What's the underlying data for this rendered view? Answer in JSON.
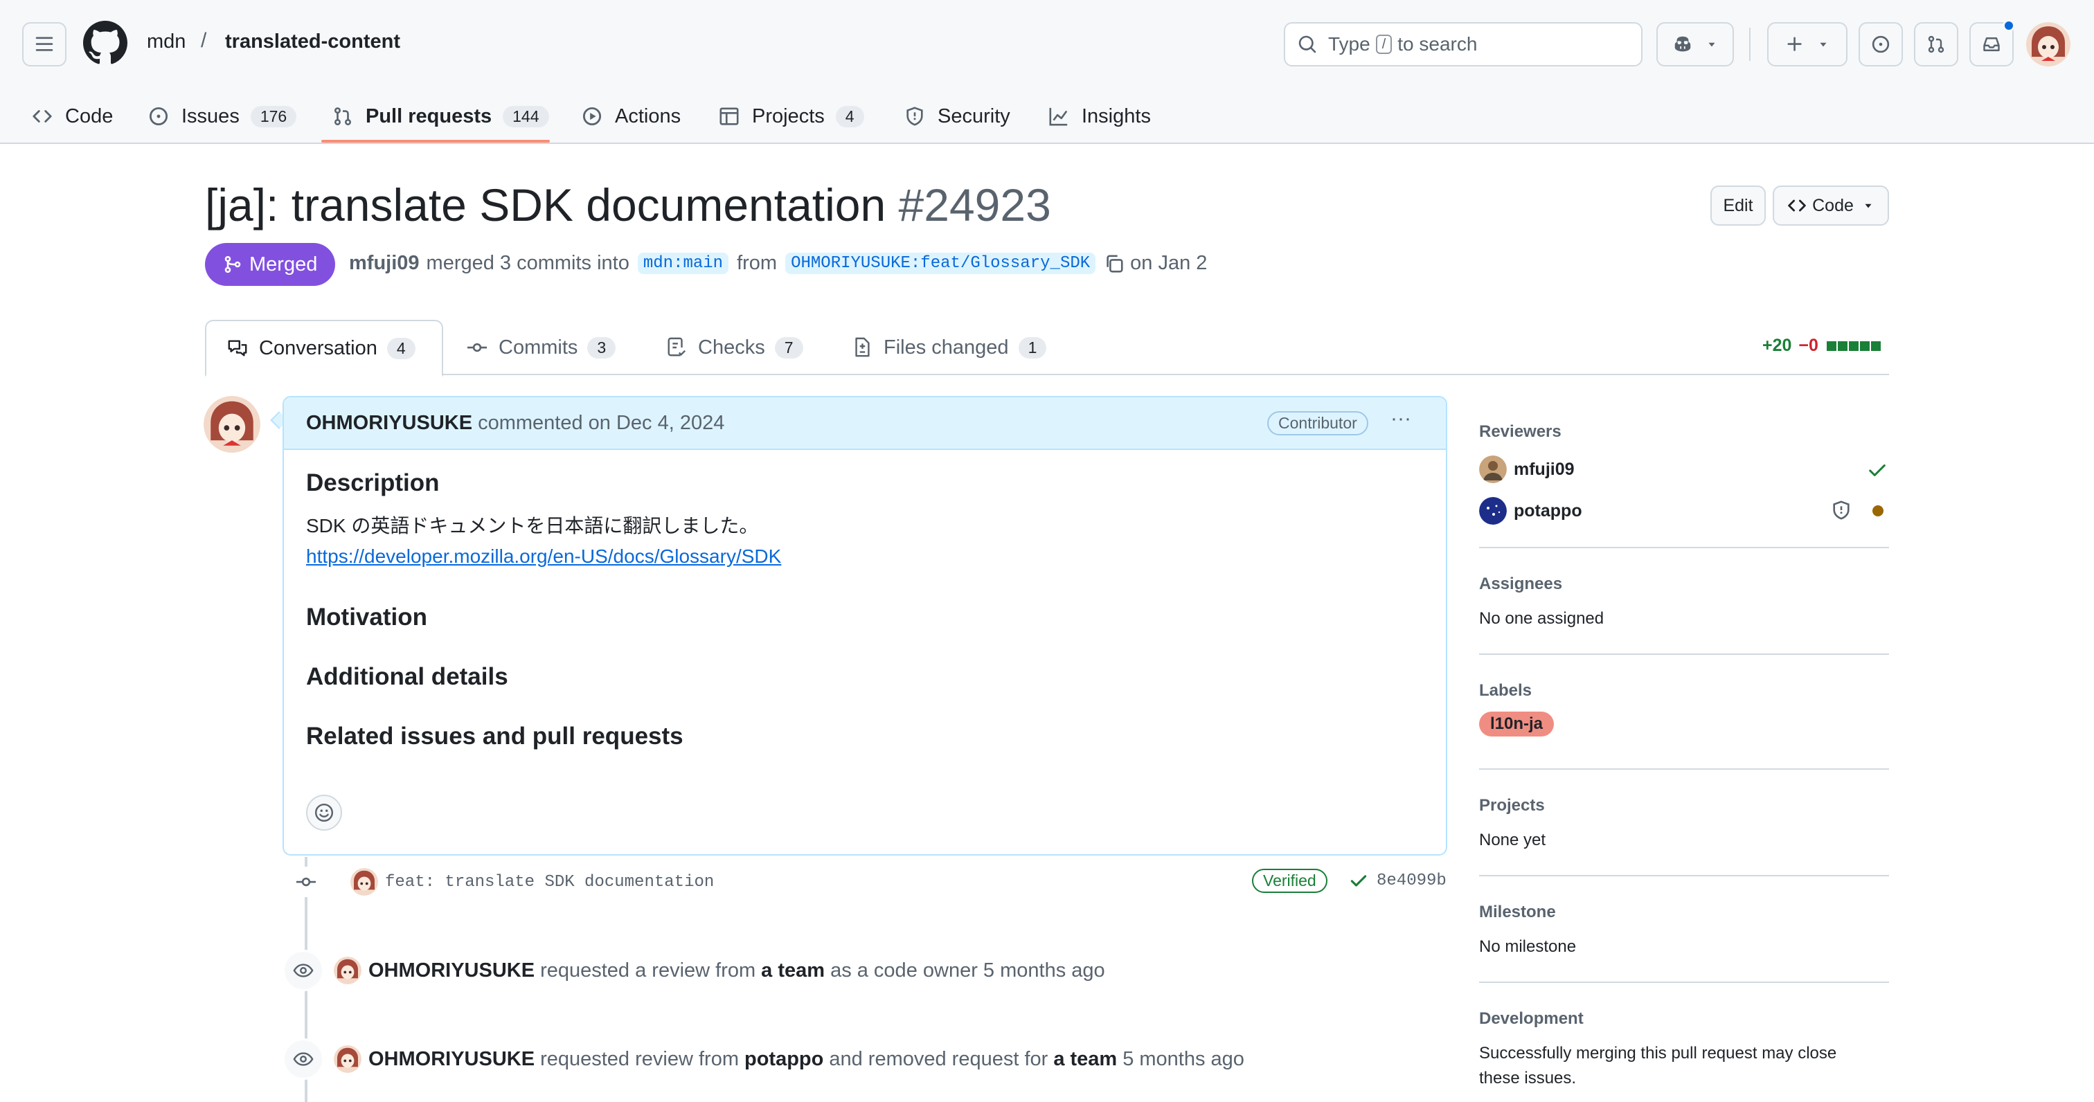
{
  "header": {
    "owner": "mdn",
    "separator": "/",
    "repo": "translated-content",
    "search": {
      "prefix": "Type",
      "key": "/",
      "suffix": "to search"
    }
  },
  "nav": {
    "items": [
      {
        "label": "Code",
        "icon": "code-icon"
      },
      {
        "label": "Issues",
        "count": "176",
        "icon": "issue-icon"
      },
      {
        "label": "Pull requests",
        "count": "144",
        "icon": "pull-request-icon"
      },
      {
        "label": "Actions",
        "icon": "play-icon"
      },
      {
        "label": "Projects",
        "count": "4",
        "icon": "table-icon"
      },
      {
        "label": "Security",
        "icon": "shield-icon"
      },
      {
        "label": "Insights",
        "icon": "graph-icon"
      }
    ]
  },
  "pr": {
    "title": "[ja]: translate SDK documentation",
    "number": "#24923",
    "edit_label": "Edit",
    "code_label": "Code",
    "state": "Merged",
    "author": "mfuji09",
    "merged_text": "merged 3 commits into",
    "base_branch": "mdn:main",
    "from_text": "from",
    "head_branch": "OHMORIYUSUKE:feat/Glossary_SDK",
    "date_text": "on Jan 2"
  },
  "tabs": [
    {
      "label": "Conversation",
      "count": "4"
    },
    {
      "label": "Commits",
      "count": "3"
    },
    {
      "label": "Checks",
      "count": "7"
    },
    {
      "label": "Files changed",
      "count": "1"
    }
  ],
  "diffstat": {
    "additions": "+20",
    "deletions": "−0"
  },
  "comment": {
    "author": "OHMORIYUSUKE",
    "when": "commented on Dec 4, 2024",
    "role": "Contributor",
    "menu": "···",
    "h_description": "Description",
    "description": "SDK の英語ドキュメントを日本語に翻訳しました。",
    "link": "https://developer.mozilla.org/en-US/docs/Glossary/SDK",
    "h_motivation": "Motivation",
    "h_additional": "Additional details",
    "h_related": "Related issues and pull requests"
  },
  "timeline": {
    "commit": {
      "message": "feat: translate SDK documentation",
      "verified": "Verified",
      "sha": "8e4099b"
    },
    "event1": {
      "actor": "OHMORIYUSUKE",
      "text1": "requested a review from",
      "target": "a team",
      "text2": "as a code owner 5 months ago"
    },
    "event2": {
      "actor": "OHMORIYUSUKE",
      "text1": "requested review from",
      "target": "potappo",
      "text2": "and removed request for",
      "target2": "a team",
      "text3": "5 months ago"
    }
  },
  "sidebar": {
    "reviewers_title": "Reviewers",
    "reviewers": [
      {
        "name": "mfuji09"
      },
      {
        "name": "potappo"
      }
    ],
    "assignees_title": "Assignees",
    "assignees_text": "No one assigned",
    "labels_title": "Labels",
    "label": "l10n-ja",
    "projects_title": "Projects",
    "projects_text": "None yet",
    "milestone_title": "Milestone",
    "milestone_text": "No milestone",
    "development_title": "Development",
    "development_text": "Successfully merging this pull request may close these issues."
  },
  "colors": {
    "merged": "#8250df",
    "accent": "#0969da",
    "additions": "#1a7f37",
    "deletions": "#cf222e",
    "label": "#f08d82"
  }
}
